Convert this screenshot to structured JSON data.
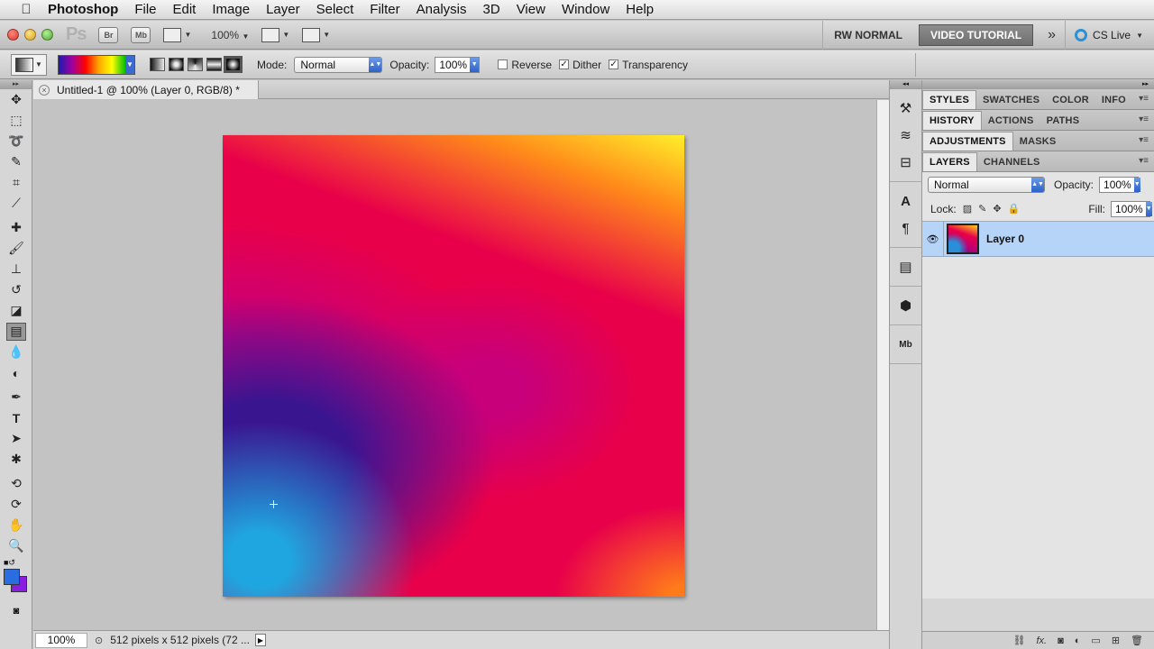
{
  "menubar": {
    "apple": "",
    "items": [
      "Photoshop",
      "File",
      "Edit",
      "Image",
      "Layer",
      "Select",
      "Filter",
      "Analysis",
      "3D",
      "View",
      "Window",
      "Help"
    ]
  },
  "appbar": {
    "logo": "Ps",
    "bridge": "Br",
    "minibridge": "Mb",
    "zoom": "100%",
    "workspaces": [
      "RW NORMAL",
      "VIDEO TUTORIAL"
    ],
    "more": "»",
    "cslive": "CS Live"
  },
  "options": {
    "mode_label": "Mode:",
    "mode_value": "Normal",
    "opacity_label": "Opacity:",
    "opacity_value": "100%",
    "reverse_label": "Reverse",
    "reverse_checked": false,
    "dither_label": "Dither",
    "dither_checked": true,
    "transparency_label": "Transparency",
    "transparency_checked": true
  },
  "document": {
    "tab_title": "Untitled-1 @ 100% (Layer 0, RGB/8) *",
    "status_zoom": "100%",
    "status_info": "512 pixels x 512 pixels (72 ..."
  },
  "tools": [
    "move-tool",
    "marquee-tool",
    "lasso-tool",
    "quick-selection-tool",
    "crop-tool",
    "eyedropper-tool",
    "spot-healing-tool",
    "brush-tool",
    "clone-stamp-tool",
    "history-brush-tool",
    "eraser-tool",
    "gradient-tool",
    "blur-tool",
    "dodge-tool",
    "pen-tool",
    "type-tool",
    "path-selection-tool",
    "shape-tool",
    "3d-rotate-tool",
    "3d-orbit-tool",
    "hand-tool",
    "zoom-tool"
  ],
  "colors": {
    "foreground": "#2a6de0",
    "background": "#8a1ee0"
  },
  "panels": {
    "row1": [
      "STYLES",
      "SWATCHES",
      "COLOR",
      "INFO"
    ],
    "row2": [
      "HISTORY",
      "ACTIONS",
      "PATHS"
    ],
    "row3": [
      "ADJUSTMENTS",
      "MASKS"
    ],
    "row4": [
      "LAYERS",
      "CHANNELS"
    ]
  },
  "layers": {
    "blend_mode": "Normal",
    "opacity_label": "Opacity:",
    "opacity_value": "100%",
    "lock_label": "Lock:",
    "fill_label": "Fill:",
    "fill_value": "100%",
    "items": [
      {
        "name": "Layer 0",
        "visible": true
      }
    ]
  }
}
